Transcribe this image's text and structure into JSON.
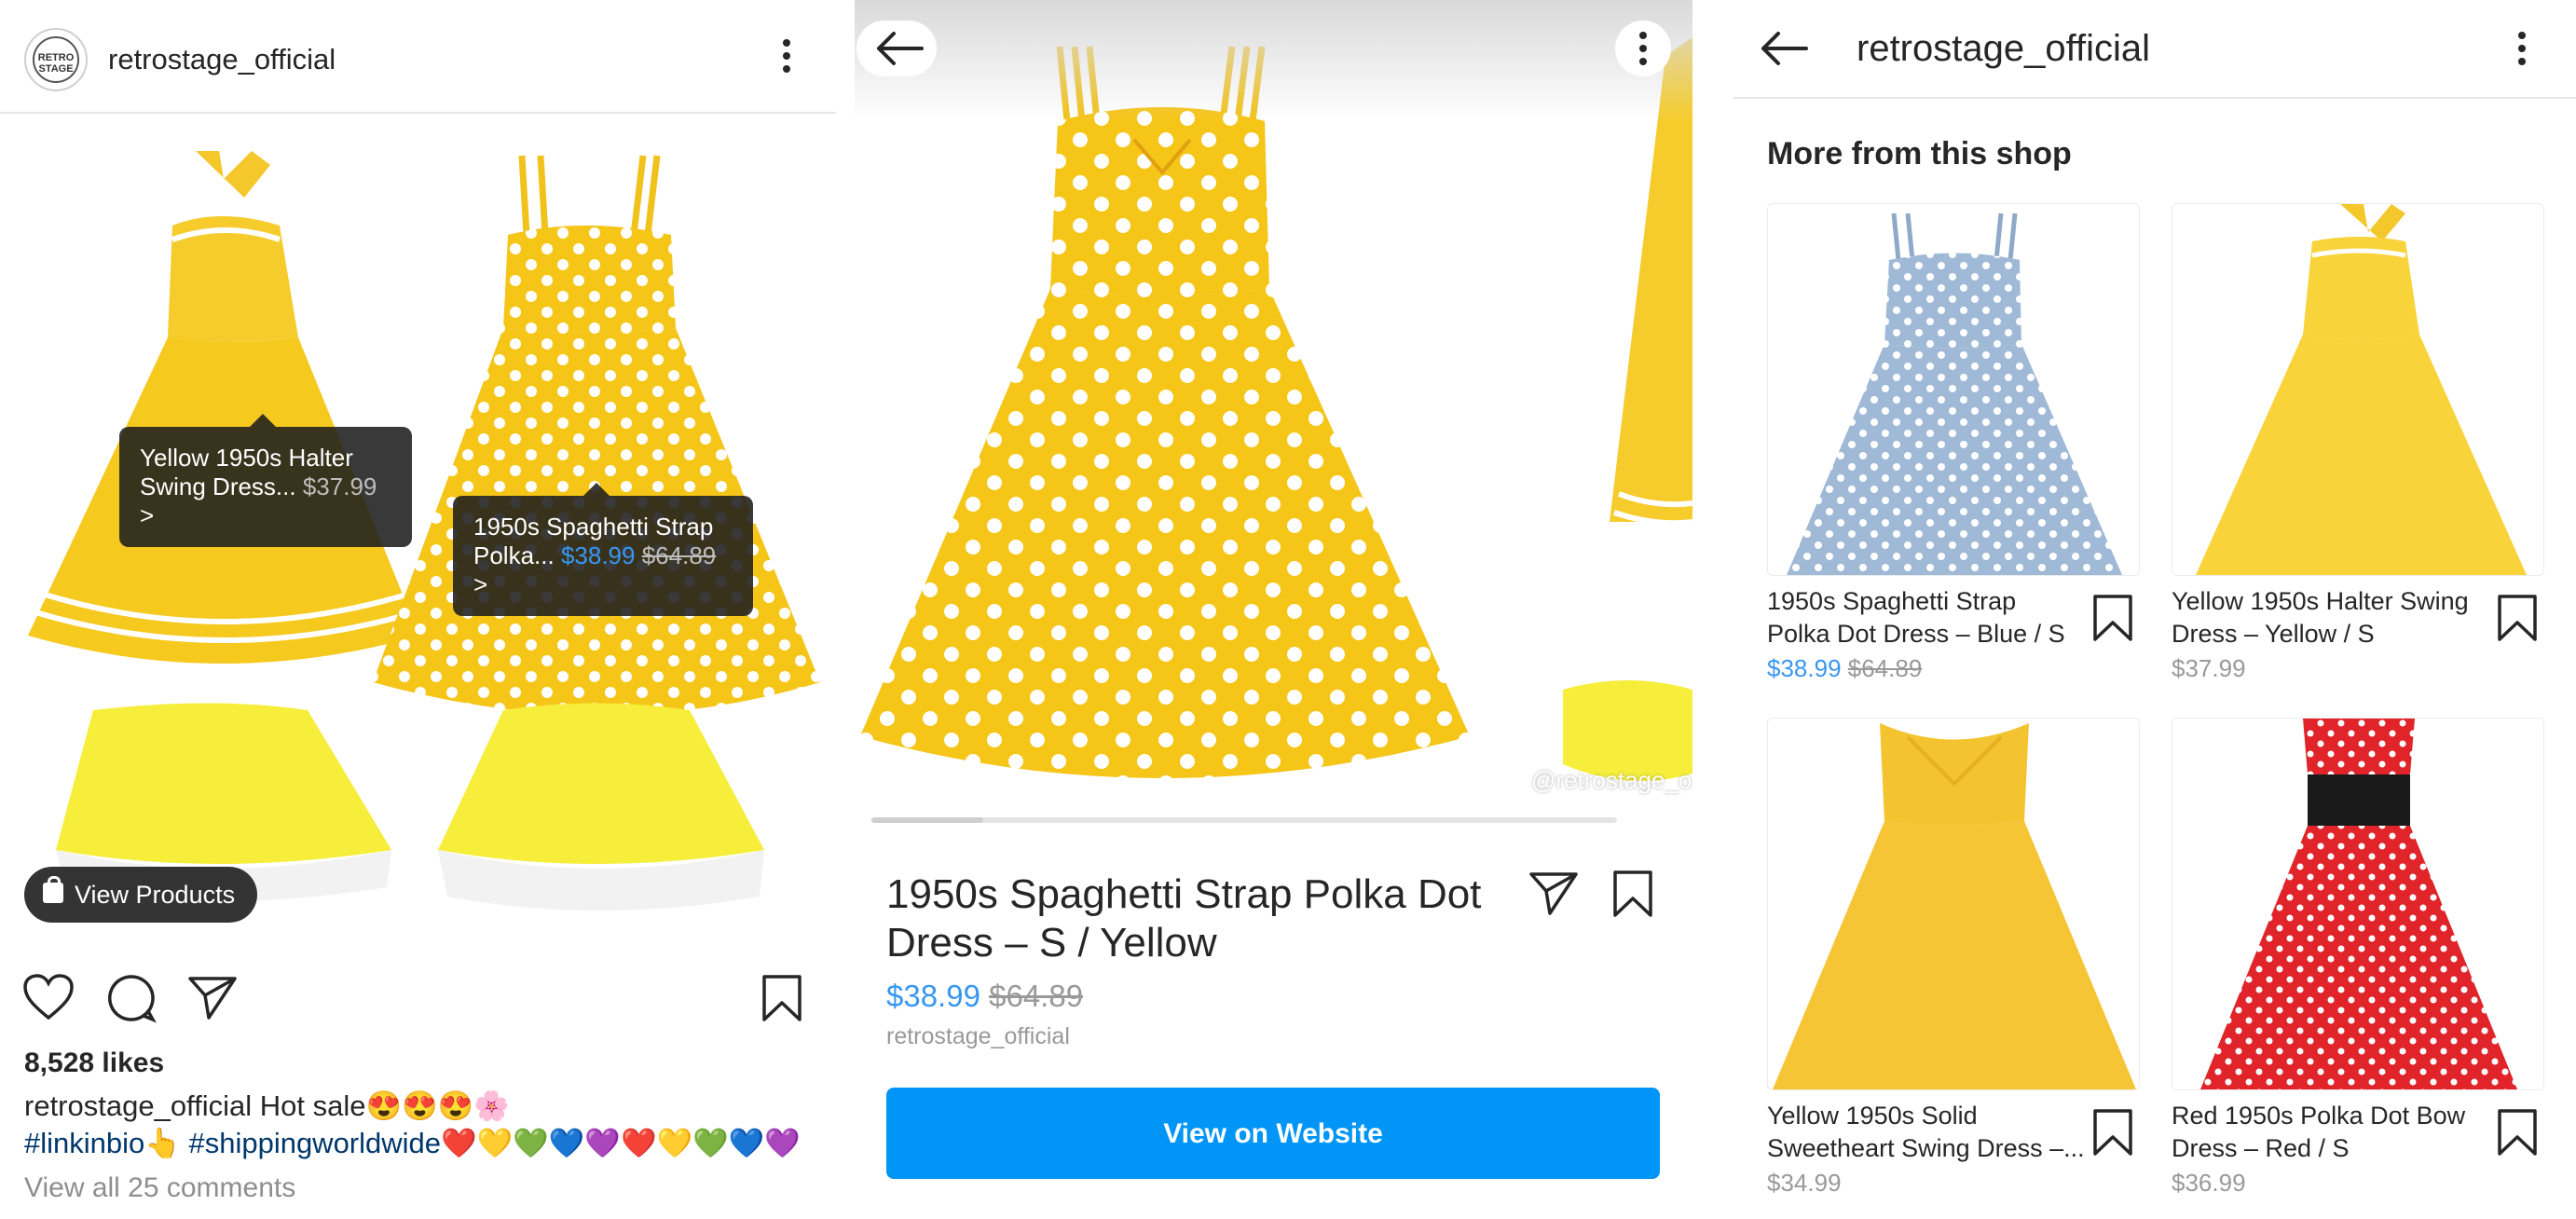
{
  "post": {
    "username": "retrostage_official",
    "avatar_text": "RETRO STAGE",
    "tags": [
      {
        "line1": "Yellow 1950s Halter",
        "line2": "Swing Dress...",
        "price": "$37.99",
        "chevron": ">"
      },
      {
        "line1": "1950s Spaghetti Strap",
        "line2": "Polka...",
        "sale_price": "$38.99",
        "orig_price": "$64.89",
        "chevron": ">"
      }
    ],
    "view_products": "View Products",
    "likes": "8,528 likes",
    "caption_user": "retrostage_official",
    "caption_text": "Hot sale😍😍😍🌸",
    "hashtags_line": "#linkinbio👆 #shippingworldwide❤️💛💚💙💜❤️💛💚💙💜",
    "view_comments": "View all 25 comments",
    "icons": [
      "heart-icon",
      "comment-icon",
      "share-icon",
      "bookmark-icon",
      "more-icon"
    ]
  },
  "product": {
    "watermark": "@retrostage_o",
    "title": "1950s Spaghetti Strap Polka Dot Dress – S / Yellow",
    "sale_price": "$38.99",
    "orig_price": "$64.89",
    "shop": "retrostage_official",
    "cta": "View on Website",
    "image_position": 0.15,
    "icons": [
      "back-arrow-icon",
      "more-icon",
      "share-icon",
      "bookmark-icon"
    ]
  },
  "shop": {
    "title": "retrostage_official",
    "section": "More from this shop",
    "items": [
      {
        "line1": "1950s Spaghetti Strap",
        "line2": "Polka Dot Dress – Blue / S",
        "sale_price": "$38.99",
        "orig_price": "$64.89",
        "color": "#9fb9d6"
      },
      {
        "line1": "Yellow 1950s Halter Swing",
        "line2": "Dress – Yellow / S",
        "price": "$37.99",
        "color": "#f8d33a"
      },
      {
        "line1": "Yellow 1950s Solid",
        "line2": "Sweetheart Swing Dress –...",
        "price": "$34.99",
        "color": "#f4c430"
      },
      {
        "line1": "Red 1950s Polka Dot Bow",
        "line2": "Dress – Red / S",
        "price": "$36.99",
        "color": "#e0242a"
      }
    ]
  },
  "colors": {
    "accent_blue": "#3897f0",
    "button_blue": "#0095f6",
    "dress_yellow": "#f6c91f",
    "text": "#262626",
    "muted": "#8e8e8e"
  }
}
